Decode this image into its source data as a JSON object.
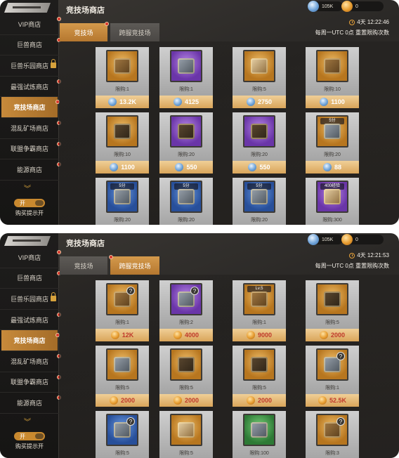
{
  "screens": [
    {
      "title": "竞技场商店",
      "resources": {
        "gems": "105K",
        "coins": "0"
      },
      "timer": "4天 12:22:46",
      "reset_note": "每周一UTC 0点 重置限购次数",
      "tabs": [
        {
          "label": "竞技场",
          "active": true
        },
        {
          "label": "跨服竞技场",
          "active": false
        }
      ],
      "sidebar": [
        "VIP商店",
        "巨兽商店",
        "巨兽乐园商店",
        "最强试炼商店",
        "竞技场商店",
        "混乱矿场商店",
        "联盟争霸商店",
        "能源商店"
      ],
      "toggle": {
        "label": "开",
        "caption": "购买提示开"
      },
      "items": [
        {
          "tag": "",
          "limit": "限购:1",
          "price": "13.2K"
        },
        {
          "tag": "",
          "limit": "限购:1",
          "price": "4125"
        },
        {
          "tag": "",
          "limit": "限购:5",
          "price": "2750"
        },
        {
          "tag": "",
          "limit": "限购:10",
          "price": "1100"
        },
        {
          "tag": "",
          "limit": "限购:10",
          "price": "1100"
        },
        {
          "tag": "",
          "limit": "限购:20",
          "price": "550"
        },
        {
          "tag": "",
          "limit": "限购:20",
          "price": "550"
        },
        {
          "tag": "5分",
          "limit": "限购:20",
          "price": "88"
        },
        {
          "tag": "5分",
          "limit": "限购:20",
          "price": ""
        },
        {
          "tag": "5分",
          "limit": "限购:20",
          "price": ""
        },
        {
          "tag": "5分",
          "limit": "限购:20",
          "price": ""
        },
        {
          "tag": "400经验",
          "limit": "限购:300",
          "price": ""
        }
      ]
    },
    {
      "title": "竞技场商店",
      "resources": {
        "gems": "105K",
        "coins": "0"
      },
      "timer": "4天 12:21:53",
      "reset_note": "每周一UTC 0点 重置限购次数",
      "tabs": [
        {
          "label": "竞技场",
          "active": false
        },
        {
          "label": "跨服竞技场",
          "active": true
        }
      ],
      "sidebar": [
        "VIP商店",
        "巨兽商店",
        "巨兽乐园商店",
        "最强试炼商店",
        "竞技场商店",
        "混乱矿场商店",
        "联盟争霸商店",
        "能源商店"
      ],
      "toggle": {
        "label": "开",
        "caption": "购买提示开"
      },
      "items": [
        {
          "tag": "",
          "limit": "限购:1",
          "price": "12K"
        },
        {
          "tag": "",
          "limit": "限购:2",
          "price": "4000"
        },
        {
          "tag": "Lv.5",
          "limit": "限购:1",
          "price": "9000"
        },
        {
          "tag": "",
          "limit": "限购:5",
          "price": "2000"
        },
        {
          "tag": "",
          "limit": "限购:5",
          "price": "2000"
        },
        {
          "tag": "",
          "limit": "限购:5",
          "price": "2000"
        },
        {
          "tag": "",
          "limit": "限购:5",
          "price": "2000"
        },
        {
          "tag": "",
          "limit": "限购:1",
          "price": "52.5K"
        },
        {
          "tag": "",
          "limit": "限购:5",
          "price": ""
        },
        {
          "tag": "",
          "limit": "限购:5",
          "price": ""
        },
        {
          "tag": "",
          "limit": "限购:100",
          "price": ""
        },
        {
          "tag": "",
          "limit": "限购:3",
          "price": ""
        }
      ]
    }
  ],
  "colors": {
    "accent": "#c78a3b",
    "price_bar": "#e4b46d",
    "badge_red": "#d9382d"
  },
  "icons": [
    "gem-coin-icon",
    "gold-coin-icon",
    "clock-icon",
    "lock-icon",
    "chevron-down-icon",
    "question-mark-icon"
  ]
}
